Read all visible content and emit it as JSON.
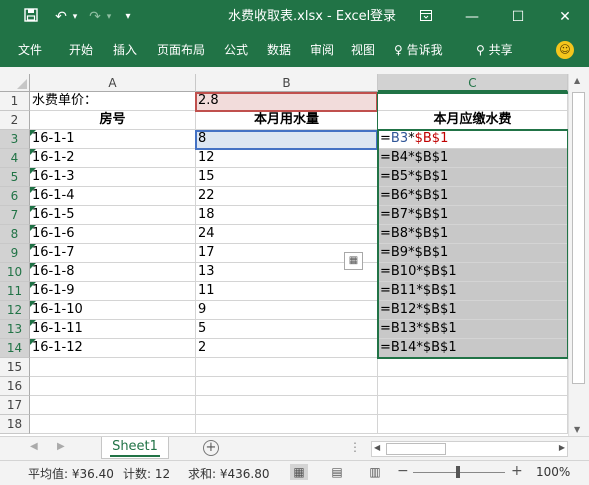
{
  "window": {
    "title": "水费收取表.xlsx - Excel",
    "login_label": "登录",
    "quick_access": {
      "save_icon": "save-icon",
      "undo_icon": "undo-icon",
      "redo_icon": "redo-icon",
      "customize_icon": "customize-icon"
    },
    "controls": {
      "ribbon_display": "ribbon-display-icon",
      "minimize": "minimize-icon",
      "maximize": "maximize-icon",
      "close": "close-icon"
    }
  },
  "ribbon": {
    "tabs": [
      "文件",
      "开始",
      "插入",
      "页面布局",
      "公式",
      "数据",
      "审阅",
      "视图"
    ],
    "tell_me": "告诉我",
    "share": "共享"
  },
  "columns": [
    "A",
    "B",
    "C"
  ],
  "rows": [
    {
      "num": "1",
      "a": "水费单价：",
      "b": "2.8",
      "c": ""
    },
    {
      "num": "2",
      "a": "房号",
      "b": "本月用水量",
      "c": "本月应缴水费"
    },
    {
      "num": "3",
      "a": "16-1-1",
      "b": "8",
      "c": "=B3*$B$1"
    },
    {
      "num": "4",
      "a": "16-1-2",
      "b": "12",
      "c": "=B4*$B$1"
    },
    {
      "num": "5",
      "a": "16-1-3",
      "b": "15",
      "c": "=B5*$B$1"
    },
    {
      "num": "6",
      "a": "16-1-4",
      "b": "22",
      "c": "=B6*$B$1"
    },
    {
      "num": "7",
      "a": "16-1-5",
      "b": "18",
      "c": "=B7*$B$1"
    },
    {
      "num": "8",
      "a": "16-1-6",
      "b": "24",
      "c": "=B8*$B$1"
    },
    {
      "num": "9",
      "a": "16-1-7",
      "b": "17",
      "c": "=B9*$B$1"
    },
    {
      "num": "10",
      "a": "16-1-8",
      "b": "13",
      "c": "=B10*$B$1"
    },
    {
      "num": "11",
      "a": "16-1-9",
      "b": "11",
      "c": "=B11*$B$1"
    },
    {
      "num": "12",
      "a": "16-1-10",
      "b": "9",
      "c": "=B12*$B$1"
    },
    {
      "num": "13",
      "a": "16-1-11",
      "b": "5",
      "c": "=B13*$B$1"
    },
    {
      "num": "14",
      "a": "16-1-12",
      "b": "2",
      "c": "=B14*$B$1"
    },
    {
      "num": "15",
      "a": "",
      "b": "",
      "c": ""
    },
    {
      "num": "16",
      "a": "",
      "b": "",
      "c": ""
    },
    {
      "num": "17",
      "a": "",
      "b": "",
      "c": ""
    },
    {
      "num": "18",
      "a": "",
      "b": "",
      "c": ""
    }
  ],
  "formula_parts": {
    "ref_blue": "B3",
    "op": "*",
    "ref_red": "$B$1"
  },
  "sheet_tab": "Sheet1",
  "status": {
    "average": "平均值: ¥36.40",
    "count": "计数: 12",
    "sum": "求和: ¥436.80",
    "zoom": "100%"
  },
  "colors": {
    "excel_green": "#217346",
    "ref_blue": "#2f5597",
    "ref_red": "#c00000",
    "selection_gray": "#c8c8c8"
  }
}
